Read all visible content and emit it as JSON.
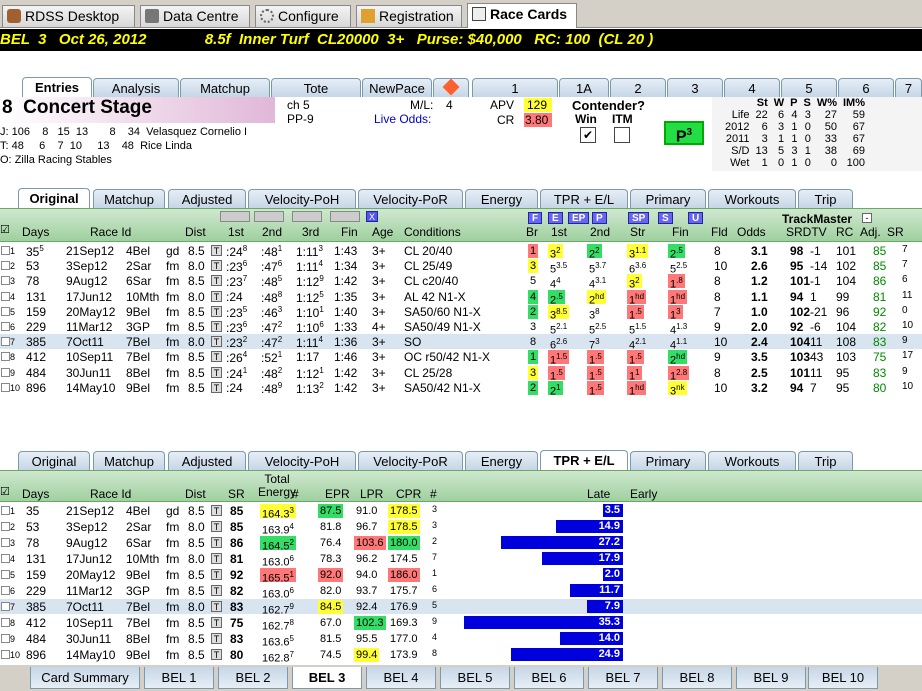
{
  "app_tabs": [
    "RDSS Desktop",
    "Data Centre",
    "Configure",
    "Registration",
    "Race Cards"
  ],
  "race_header": "BEL  3   Oct 26, 2012              8.5f  Inner Turf  CL20000  3+   Purse: $40,000   RC: 100  (CL 20 )",
  "horse_tabs": [
    "Entries",
    "Analysis",
    "Matchup",
    "Tote",
    "NewPace",
    "",
    "1",
    "1A",
    "2",
    "3",
    "4",
    "5",
    "6",
    "7"
  ],
  "horse": {
    "number": "8",
    "name": "Concert Stage",
    "color": "ch 5",
    "pp": "PP-9",
    "ml_label": "M/L:",
    "ml": "4",
    "live_odds": "Live Odds:",
    "apv_label": "APV",
    "apv": "129",
    "cr_label": "CR",
    "cr": "3.80",
    "contender": "Contender?",
    "win": "Win",
    "itm": "ITM",
    "p3": "P",
    "p3sup": "3"
  },
  "jockey": {
    "label": "J:",
    "stats": "106    8   15  13       8    34",
    "name": "Velasquez Cornelio I"
  },
  "trainer": {
    "label": "T:",
    "stats": "48     6    7  10     13    48",
    "name": "Rice Linda"
  },
  "owner": {
    "label": "O:",
    "name": "Zilla Racing Stables"
  },
  "stats_table": {
    "headers": [
      "",
      "St",
      "W",
      "P",
      "S",
      "W%",
      "IM%"
    ],
    "rows": [
      [
        "Life",
        "22",
        "6",
        "4",
        "3",
        "27",
        "59"
      ],
      [
        "2012",
        "6",
        "3",
        "1",
        "0",
        "50",
        "67"
      ],
      [
        "2011",
        "3",
        "1",
        "1",
        "0",
        "33",
        "67"
      ],
      [
        "S/D",
        "13",
        "5",
        "3",
        "1",
        "38",
        "69"
      ],
      [
        "Wet",
        "1",
        "0",
        "1",
        "0",
        "0",
        "100"
      ]
    ]
  },
  "pp_tabs": [
    "Original",
    "Matchup",
    "Adjusted",
    "Velocity-PoH",
    "Velocity-PoR",
    "Energy",
    "TPR + E/L",
    "Primary",
    "Workouts",
    "Trip"
  ],
  "pp_headers": {
    "days": "Days",
    "race_id": "Race Id",
    "dist": "Dist",
    "first": "1st",
    "second": "2nd",
    "third": "3rd",
    "fin": "Fin",
    "age": "Age",
    "cond": "Conditions",
    "br": "Br",
    "c1": "1st",
    "c2": "2nd",
    "str": "Str",
    "cfin": "Fin",
    "fld": "Fld",
    "odds": "Odds",
    "srdtv": "SRDTV",
    "rc": "RC",
    "adj": "Adj.",
    "sr": "SR",
    "trackmaster": "TrackMaster"
  },
  "pace_buttons": [
    "F",
    "E",
    "EP",
    "P",
    "SP",
    "S",
    "U"
  ],
  "pp_rows": [
    [
      "1",
      "35",
      "21Sep12",
      "4Bel",
      "gd",
      "8.5",
      ":24",
      "8",
      ":48",
      "1",
      ":1:13",
      "3",
      "1:43",
      "3+",
      "CL 20/40",
      "1",
      "3",
      "2",
      "2",
      "2",
      "3",
      "1.1",
      "2",
      ".5",
      "8",
      "3.1",
      "98",
      "-1",
      "101",
      "85",
      "7"
    ],
    [
      "2",
      "53",
      "3Sep12",
      "2Sar",
      "fm",
      "8.0",
      ":23",
      "6",
      ":47",
      "6",
      "1:11",
      "4",
      "1:34",
      "8",
      "3+",
      "CL 25/49"
    ],
    [
      "3",
      "78",
      "9Aug12",
      "6Sar",
      "fm",
      "8.5",
      ":23",
      "7",
      ":48",
      "5",
      "1:12",
      "9",
      "1:42",
      "1",
      "3+",
      "CL c20/40"
    ],
    [
      "4",
      "131",
      "17Jun12",
      "10Mth",
      "fm",
      "8.0",
      ":24",
      ":48",
      "8",
      "1:12",
      "5",
      "1:35",
      "6",
      "3+",
      "AL 42 N1-X"
    ],
    [
      "5",
      "159",
      "20May12",
      "9Bel",
      "fm",
      "8.5",
      ":23",
      "5",
      ":46",
      "3",
      "1:10",
      "1",
      "1:40",
      "4",
      "3+",
      "SA50/60 N1-X"
    ],
    [
      "6",
      "229",
      "11Mar12",
      "3GP",
      "fm",
      "8.5",
      ":23",
      "6",
      ":47",
      "2",
      "1:10",
      "6",
      "1:33",
      "9",
      "4+",
      "SA50/49 N1-X"
    ],
    [
      "7",
      "385",
      "7Oct11",
      "7Bel",
      "fm",
      "8.0",
      ":23",
      "2",
      ":47",
      "2",
      "1:11",
      "4",
      "1:36",
      "3+",
      "SO"
    ],
    [
      "8",
      "412",
      "10Sep11",
      "7Bel",
      "fm",
      "8.5",
      ":26",
      "4",
      ":52",
      "1",
      "1:17",
      "1:46",
      "9",
      "3+",
      "OC r50/42 N1-X"
    ],
    [
      "9",
      "484",
      "30Jun11",
      "8Bel",
      "fm",
      "8.5",
      ":24",
      "1",
      ":48",
      "2",
      "1:12",
      "1",
      "1:42",
      "1",
      "3+",
      "CL 25/28"
    ],
    [
      "10",
      "896",
      "14May10",
      "9Bel",
      "fm",
      "8.5",
      ":24",
      ":48",
      "9",
      "1:13",
      "2",
      "1:42",
      "3",
      "3+",
      "SA50/42 N1-X"
    ]
  ],
  "pp_table": [
    {
      "n": "1",
      "days": "35",
      "dsup": "5",
      "date": "21Sep12",
      "rid": "4Bel",
      "sf": "gd",
      "d": "8.5",
      "f1": ":24",
      "f1s": "8",
      "f2": ":48",
      "f2s": "1",
      "f3": "1:11",
      "f3s": "3",
      "fin": "1:43",
      "age": "3+",
      "cond": "CL 20/40",
      "br": "1",
      "c1": "3",
      "c1s": "2",
      "c2": "2",
      "c2s": "2",
      "st": "3",
      "sts": "1.1",
      "cf": "2",
      "cfs": ".5",
      "fld": "8",
      "odds": "3.1",
      "srd": "98",
      "tv": "-1",
      "rc": "101",
      "adj": "85",
      "sr": "7"
    },
    {
      "n": "2",
      "days": "53",
      "dsup": "",
      "date": "3Sep12",
      "rid": "2Sar",
      "sf": "fm",
      "d": "8.0",
      "f1": ":23",
      "f1s": "6",
      "f2": ":47",
      "f2s": "6",
      "f3": "1:11",
      "f3s": "4",
      "fin": "1:34",
      "age": "3+",
      "cond": "CL 25/49",
      "br": "3",
      "c1": "5",
      "c1s": "3.5",
      "c2": "5",
      "c2s": "3.7",
      "st": "6",
      "sts": "3.6",
      "cf": "5",
      "cfs": "2.5",
      "fld": "10",
      "odds": "2.6",
      "srd": "95",
      "tv": "-14",
      "rc": "102",
      "adj": "85",
      "sr": "7"
    },
    {
      "n": "3",
      "days": "78",
      "dsup": "",
      "date": "9Aug12",
      "rid": "6Sar",
      "sf": "fm",
      "d": "8.5",
      "f1": ":23",
      "f1s": "7",
      "f2": ":48",
      "f2s": "5",
      "f3": "1:12",
      "f3s": "9",
      "fin": "1:42",
      "age": "3+",
      "cond": "CL c20/40",
      "br": "5",
      "c1": "4",
      "c1s": "4",
      "c2": "4",
      "c2s": "3.1",
      "st": "3",
      "sts": "2",
      "cf": "1",
      "cfs": ".8",
      "fld": "8",
      "odds": "1.2",
      "srd": "101",
      "tv": "-1",
      "rc": "104",
      "adj": "86",
      "sr": "6"
    },
    {
      "n": "4",
      "days": "131",
      "dsup": "",
      "date": "17Jun12",
      "rid": "10Mth",
      "sf": "fm",
      "d": "8.0",
      "f1": ":24",
      "f1s": "",
      "f2": ":48",
      "f2s": "8",
      "f3": "1:12",
      "f3s": "5",
      "fin": "1:35",
      "age": "3+",
      "cond": "AL 42 N1-X",
      "br": "4",
      "c1": "2",
      "c1s": ".5",
      "c2": "2",
      "c2s": "hd",
      "st": "1",
      "sts": "hd",
      "cf": "1",
      "cfs": "hd",
      "fld": "8",
      "odds": "1.1",
      "srd": "94",
      "tv": "1",
      "rc": "99",
      "adj": "81",
      "sr": "11"
    },
    {
      "n": "5",
      "days": "159",
      "dsup": "",
      "date": "20May12",
      "rid": "9Bel",
      "sf": "fm",
      "d": "8.5",
      "f1": ":23",
      "f1s": "5",
      "f2": ":46",
      "f2s": "3",
      "f3": "1:10",
      "f3s": "1",
      "fin": "1:40",
      "age": "3+",
      "cond": "SA50/60 N1-X",
      "br": "2",
      "c1": "3",
      "c1s": "8.5",
      "c2": "3",
      "c2s": "8",
      "st": "1",
      "sts": ".5",
      "cf": "1",
      "cfs": "3",
      "fld": "7",
      "odds": "1.0",
      "srd": "102",
      "tv": "-21",
      "rc": "96",
      "adj": "92",
      "sr": "0"
    },
    {
      "n": "6",
      "days": "229",
      "dsup": "",
      "date": "11Mar12",
      "rid": "3GP",
      "sf": "fm",
      "d": "8.5",
      "f1": ":23",
      "f1s": "6",
      "f2": ":47",
      "f2s": "2",
      "f3": "1:10",
      "f3s": "6",
      "fin": "1:33",
      "age": "4+",
      "cond": "SA50/49 N1-X",
      "br": "3",
      "c1": "5",
      "c1s": "2.1",
      "c2": "5",
      "c2s": "2.5",
      "st": "5",
      "sts": "1.5",
      "cf": "4",
      "cfs": "1.3",
      "fld": "9",
      "odds": "2.0",
      "srd": "92",
      "tv": "-6",
      "rc": "104",
      "adj": "82",
      "sr": "10"
    },
    {
      "n": "7",
      "days": "385",
      "dsup": "",
      "date": "7Oct11",
      "rid": "7Bel",
      "sf": "fm",
      "d": "8.0",
      "f1": ":23",
      "f1s": "2",
      "f2": ":47",
      "f2s": "2",
      "f3": "1:11",
      "f3s": "4",
      "fin": "1:36",
      "age": "3+",
      "cond": "SO",
      "br": "8",
      "c1": "6",
      "c1s": "2.6",
      "c2": "7",
      "c2s": "3",
      "st": "4",
      "sts": "2.1",
      "cf": "4",
      "cfs": "1.1",
      "fld": "10",
      "odds": "2.4",
      "srd": "104",
      "tv": "11",
      "rc": "108",
      "adj": "83",
      "sr": "9"
    },
    {
      "n": "8",
      "days": "412",
      "dsup": "",
      "date": "10Sep11",
      "rid": "7Bel",
      "sf": "fm",
      "d": "8.5",
      "f1": ":26",
      "f1s": "4",
      "f2": ":52",
      "f2s": "1",
      "f3": "1:17",
      "f3s": "",
      "fin": "1:46",
      "age": "3+",
      "cond": "OC r50/42 N1-X",
      "br": "1",
      "c1": "1",
      "c1s": "1.5",
      "c2": "1",
      "c2s": ".5",
      "st": "1",
      "sts": ".5",
      "cf": "2",
      "cfs": "hd",
      "fld": "9",
      "odds": "3.5",
      "srd": "103",
      "tv": "43",
      "rc": "103",
      "adj": "75",
      "sr": "17"
    },
    {
      "n": "9",
      "days": "484",
      "dsup": "",
      "date": "30Jun11",
      "rid": "8Bel",
      "sf": "fm",
      "d": "8.5",
      "f1": ":24",
      "f1s": "1",
      "f2": ":48",
      "f2s": "2",
      "f3": "1:12",
      "f3s": "1",
      "fin": "1:42",
      "age": "3+",
      "cond": "CL 25/28",
      "br": "3",
      "c1": "1",
      "c1s": ".5",
      "c2": "1",
      "c2s": ".5",
      "st": "1",
      "sts": "1",
      "cf": "1",
      "cfs": "2.8",
      "fld": "8",
      "odds": "2.5",
      "srd": "101",
      "tv": "11",
      "rc": "95",
      "adj": "83",
      "sr": "9"
    },
    {
      "n": "10",
      "days": "896",
      "dsup": "",
      "date": "14May10",
      "rid": "9Bel",
      "sf": "fm",
      "d": "8.5",
      "f1": ":24",
      "f1s": "",
      "f2": ":48",
      "f2s": "9",
      "f3": "1:13",
      "f3s": "2",
      "fin": "1:42",
      "age": "3+",
      "cond": "SA50/42 N1-X",
      "br": "2",
      "c1": "2",
      "c1s": "1",
      "c2": "1",
      "c2s": ".5",
      "st": "1",
      "sts": "hd",
      "cf": "3",
      "cfs": "nk",
      "fld": "10",
      "odds": "3.2",
      "srd": "94",
      "tv": "7",
      "rc": "95",
      "adj": "80",
      "sr": "10"
    }
  ],
  "tpr_tabs": [
    "Original",
    "Matchup",
    "Adjusted",
    "Velocity-PoH",
    "Velocity-PoR",
    "Energy",
    "TPR + E/L",
    "Primary",
    "Workouts",
    "Trip"
  ],
  "tpr_headers": {
    "days": "Days",
    "race_id": "Race Id",
    "dist": "Dist",
    "sr": "SR",
    "total_energy": "Total Energy",
    "hash": "#",
    "epr": "EPR",
    "lpr": "LPR",
    "cpr": "CPR",
    "late": "Late",
    "early": "Early"
  },
  "tpr_rows": [
    {
      "n": "1",
      "days": "35",
      "date": "21Sep12",
      "rid": "4Bel",
      "sf": "gd",
      "d": "8.5",
      "sr": "85",
      "te": "164.3",
      "tes": "3",
      "epr": "87.5",
      "lpr": "91.0",
      "cpr": "178.5",
      "cprs": "3",
      "late": "3.5"
    },
    {
      "n": "2",
      "days": "53",
      "date": "3Sep12",
      "rid": "2Sar",
      "sf": "fm",
      "d": "8.0",
      "sr": "85",
      "te": "163.9",
      "tes": "4",
      "epr": "81.8",
      "lpr": "96.7",
      "cpr": "178.5",
      "cprs": "3",
      "late": "14.9"
    },
    {
      "n": "3",
      "days": "78",
      "date": "9Aug12",
      "rid": "6Sar",
      "sf": "fm",
      "d": "8.5",
      "sr": "86",
      "te": "164.5",
      "tes": "2",
      "epr": "76.4",
      "lpr": "103.6",
      "cpr": "180.0",
      "cprs": "2",
      "late": "27.2"
    },
    {
      "n": "4",
      "days": "131",
      "date": "17Jun12",
      "rid": "10Mth",
      "sf": "fm",
      "d": "8.0",
      "sr": "81",
      "te": "163.0",
      "tes": "6",
      "epr": "78.3",
      "lpr": "96.2",
      "cpr": "174.5",
      "cprs": "7",
      "late": "17.9"
    },
    {
      "n": "5",
      "days": "159",
      "date": "20May12",
      "rid": "9Bel",
      "sf": "fm",
      "d": "8.5",
      "sr": "92",
      "te": "165.5",
      "tes": "1",
      "epr": "92.0",
      "lpr": "94.0",
      "cpr": "186.0",
      "cprs": "1",
      "late": "2.0"
    },
    {
      "n": "6",
      "days": "229",
      "date": "11Mar12",
      "rid": "3GP",
      "sf": "fm",
      "d": "8.5",
      "sr": "82",
      "te": "163.0",
      "tes": "6",
      "epr": "82.0",
      "lpr": "93.7",
      "cpr": "175.7",
      "cprs": "6",
      "late": "11.7"
    },
    {
      "n": "7",
      "days": "385",
      "date": "7Oct11",
      "rid": "7Bel",
      "sf": "fm",
      "d": "8.0",
      "sr": "83",
      "te": "162.7",
      "tes": "9",
      "epr": "84.5",
      "lpr": "92.4",
      "cpr": "176.9",
      "cprs": "5",
      "late": "7.9"
    },
    {
      "n": "8",
      "days": "412",
      "date": "10Sep11",
      "rid": "7Bel",
      "sf": "fm",
      "d": "8.5",
      "sr": "75",
      "te": "162.7",
      "tes": "8",
      "epr": "67.0",
      "lpr": "102.3",
      "cpr": "169.3",
      "cprs": "9",
      "late": "35.3"
    },
    {
      "n": "9",
      "days": "484",
      "date": "30Jun11",
      "rid": "8Bel",
      "sf": "fm",
      "d": "8.5",
      "sr": "83",
      "te": "163.6",
      "tes": "5",
      "epr": "81.5",
      "lpr": "95.5",
      "cpr": "177.0",
      "cprs": "4",
      "late": "14.0"
    },
    {
      "n": "10",
      "days": "896",
      "date": "14May10",
      "rid": "9Bel",
      "sf": "fm",
      "d": "8.5",
      "sr": "80",
      "te": "162.8",
      "tes": "7",
      "epr": "74.5",
      "lpr": "99.4",
      "cpr": "173.9",
      "cprs": "8",
      "late": "24.9"
    }
  ],
  "bottom_tabs": [
    "Card Summary",
    "BEL 1",
    "BEL 2",
    "BEL 3",
    "BEL 4",
    "BEL 5",
    "BEL 6",
    "BEL 7",
    "BEL 8",
    "BEL 9",
    "BEL 10"
  ]
}
